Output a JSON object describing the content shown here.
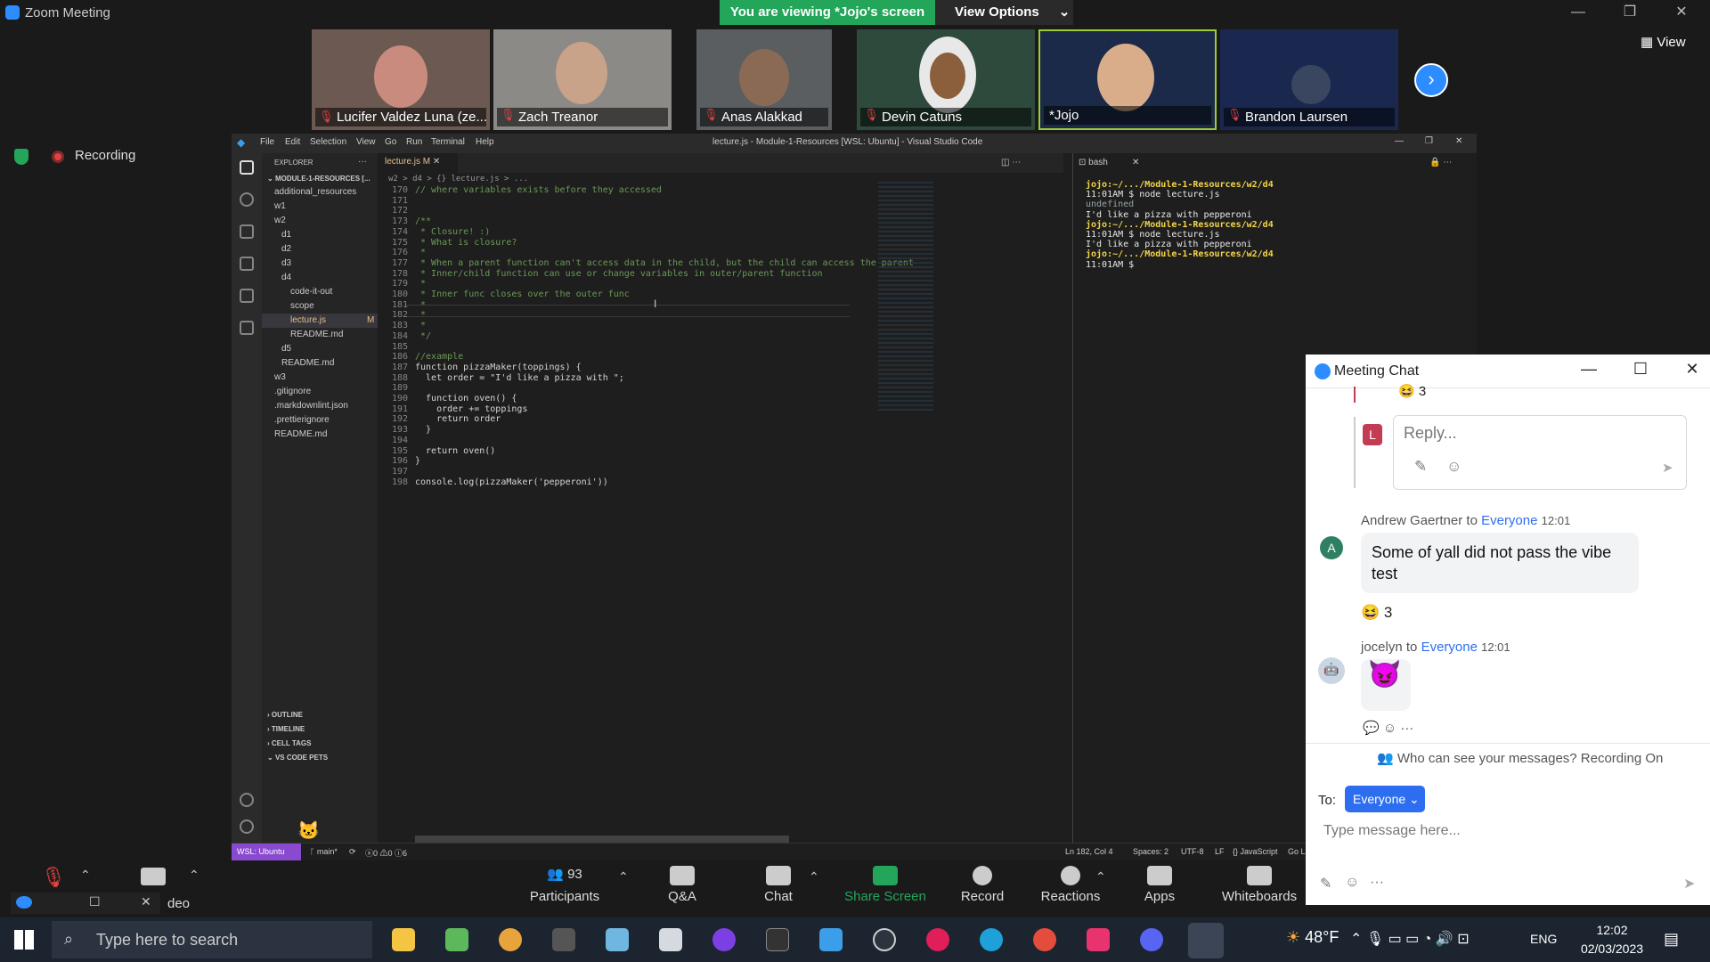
{
  "zoom": {
    "window_title": "Zoom Meeting",
    "viewing_banner": "You are viewing *Jojo's screen",
    "view_options": "View Options",
    "view_label": "View",
    "recording_label": "Recording"
  },
  "participants": [
    {
      "name": "Lucifer Valdez Luna (ze...",
      "muted": true
    },
    {
      "name": "Zach Treanor",
      "muted": true
    },
    {
      "name": "Anas Alakkad",
      "muted": true
    },
    {
      "name": "Devin Catuns",
      "muted": true
    },
    {
      "name": "*Jojo",
      "muted": false
    },
    {
      "name": "Brandon Laursen",
      "muted": true
    }
  ],
  "vscode": {
    "menu": [
      "File",
      "Edit",
      "Selection",
      "View",
      "Go",
      "Run",
      "Terminal",
      "Help"
    ],
    "title": "lecture.js - Module-1-Resources [WSL: Ubuntu] - Visual Studio Code",
    "explorer_label": "EXPLORER",
    "root_folder": "MODULE-1-RESOURCES [...",
    "tree": [
      "additional_resources",
      "w1",
      "w2",
      "d1",
      "d2",
      "d3",
      "d4",
      "code-it-out",
      "scope",
      "lecture.js",
      "README.md",
      "d5",
      "README.md",
      "w3",
      ".gitignore",
      ".markdownlint.json",
      ".prettierignore",
      "README.md"
    ],
    "sections": [
      "OUTLINE",
      "TIMELINE",
      "CELL TAGS",
      "VS CODE PETS"
    ],
    "tab": "lecture.js",
    "tab_modified": "M",
    "breadcrumb": "w2 > d4 > {} lecture.js > ...",
    "code_lines": [
      {
        "n": "170",
        "t": "// where variables exists before they accessed",
        "c": "comment"
      },
      {
        "n": "171",
        "t": "",
        "c": "plain"
      },
      {
        "n": "172",
        "t": "",
        "c": "plain"
      },
      {
        "n": "173",
        "t": "/**",
        "c": "comment"
      },
      {
        "n": "174",
        "t": " * Closure! :)",
        "c": "comment"
      },
      {
        "n": "175",
        "t": " * What is closure?",
        "c": "comment"
      },
      {
        "n": "176",
        "t": " *",
        "c": "comment"
      },
      {
        "n": "177",
        "t": " * When a parent function can't access data in the child, but the child can access the parent",
        "c": "comment"
      },
      {
        "n": "178",
        "t": " * Inner/child function can use or change variables in outer/parent function",
        "c": "comment"
      },
      {
        "n": "179",
        "t": " *",
        "c": "comment"
      },
      {
        "n": "180",
        "t": " * Inner func closes over the outer func",
        "c": "comment"
      },
      {
        "n": "181",
        "t": " *",
        "c": "comment"
      },
      {
        "n": "182",
        "t": " *",
        "c": "comment"
      },
      {
        "n": "183",
        "t": " *",
        "c": "comment"
      },
      {
        "n": "184",
        "t": " */",
        "c": "comment"
      },
      {
        "n": "185",
        "t": "",
        "c": "plain"
      },
      {
        "n": "186",
        "t": "//example",
        "c": "comment"
      },
      {
        "n": "187",
        "t": "function pizzaMaker(toppings) {",
        "c": "code"
      },
      {
        "n": "188",
        "t": "  let order = \"I'd like a pizza with \";",
        "c": "code"
      },
      {
        "n": "189",
        "t": "",
        "c": "plain"
      },
      {
        "n": "190",
        "t": "  function oven() {",
        "c": "code"
      },
      {
        "n": "191",
        "t": "    order += toppings",
        "c": "code"
      },
      {
        "n": "192",
        "t": "    return order",
        "c": "code"
      },
      {
        "n": "193",
        "t": "  }",
        "c": "code"
      },
      {
        "n": "194",
        "t": "",
        "c": "plain"
      },
      {
        "n": "195",
        "t": "  return oven()",
        "c": "code"
      },
      {
        "n": "196",
        "t": "}",
        "c": "code"
      },
      {
        "n": "197",
        "t": "",
        "c": "plain"
      },
      {
        "n": "198",
        "t": "console.log(pizzaMaker('pepperoni'))",
        "c": "code"
      }
    ],
    "terminal_tab": "bash",
    "terminal_lines": [
      {
        "t": "jojo:~/.../Module-1-Resources/w2/d4",
        "c": "prompt"
      },
      {
        "t": "11:01AM $ node lecture.js",
        "c": "plain"
      },
      {
        "t": "undefined",
        "c": "dim"
      },
      {
        "t": "I'd like a pizza with pepperoni",
        "c": "plain"
      },
      {
        "t": "jojo:~/.../Module-1-Resources/w2/d4",
        "c": "prompt"
      },
      {
        "t": "11:01AM $ node lecture.js",
        "c": "plain"
      },
      {
        "t": "I'd like a pizza with pepperoni",
        "c": "plain"
      },
      {
        "t": "jojo:~/.../Module-1-Resources/w2/d4",
        "c": "prompt"
      },
      {
        "t": "11:01AM $ ",
        "c": "plain"
      }
    ],
    "status": {
      "remote": "WSL: Ubuntu",
      "branch": "main*",
      "problems": "0 ⚠0 ⓘ6",
      "position": "Ln 182, Col 4",
      "spaces": "Spaces: 2",
      "encoding": "UTF-8",
      "eol": "LF",
      "language": "{} JavaScript",
      "golive": "Go Li"
    }
  },
  "chat": {
    "title": "Meeting Chat",
    "prev_reaction": "😆 3",
    "reply_placeholder": "Reply...",
    "messages": [
      {
        "sender": "Andrew Gaertner",
        "to": "Everyone",
        "time": "12:01",
        "text": "Some of yall did not pass the vibe test",
        "reaction": "😆 3",
        "avatar": "A"
      },
      {
        "sender": "jocelyn",
        "to": "Everyone",
        "time": "12:01",
        "text": "😈",
        "avatar": ""
      }
    ],
    "to_word": "to",
    "privacy": "Who can see your messages? Recording On",
    "to_label": "To:",
    "to_value": "Everyone",
    "input_placeholder": "Type message here..."
  },
  "toolbar": {
    "video_label": "deo",
    "participants_count": "93",
    "buttons": [
      "Participants",
      "Q&A",
      "Chat",
      "Share Screen",
      "Record",
      "Reactions",
      "Apps",
      "Whiteboards"
    ]
  },
  "taskbar": {
    "search_placeholder": "Type here to search",
    "weather": "48°F",
    "lang": "ENG",
    "time": "12:02",
    "date": "02/03/2023"
  },
  "colors": {
    "zoom_blue": "#2d8cff",
    "green": "#23a55a",
    "vscode_bg": "#1e1e1e",
    "chat_link": "#2d6ef0"
  }
}
